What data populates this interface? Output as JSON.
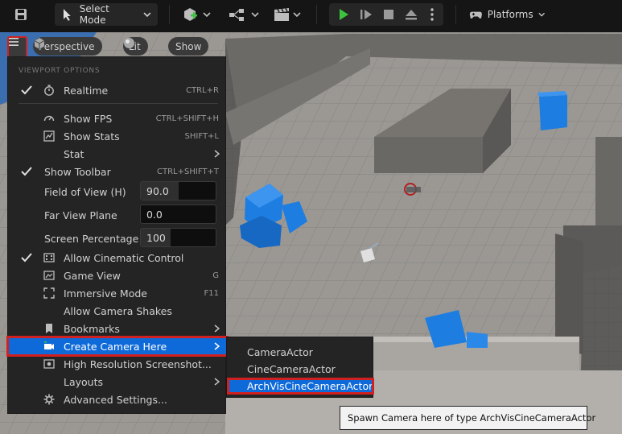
{
  "toolbar": {
    "save_icon": "save-icon",
    "select_mode_label": "Select Mode",
    "add_icon": "add-actor-icon",
    "blueprint_icon": "blueprint-icon",
    "cinematics_icon": "clapperboard-icon",
    "play_icons": [
      "play-icon",
      "advance-frame-icon",
      "stop-icon",
      "eject-icon",
      "kebab-icon"
    ],
    "play_color": "#3cc23c",
    "platforms_label": "Platforms"
  },
  "viewport_toolbar": {
    "perspective_label": "Perspective",
    "lit_label": "Lit",
    "show_label": "Show"
  },
  "menu": {
    "heading": "VIEWPORT OPTIONS",
    "items": [
      {
        "label": "Realtime",
        "shortcut": "CTRL+R",
        "checked": true,
        "icon": "stopwatch-icon"
      },
      {
        "label": "Show FPS",
        "shortcut": "CTRL+SHIFT+H",
        "checked": false,
        "icon": "speedometer-icon"
      },
      {
        "label": "Show Stats",
        "shortcut": "SHIFT+L",
        "checked": false,
        "icon": "stats-icon"
      },
      {
        "label": "Stat",
        "shortcut": "",
        "checked": false,
        "icon": "",
        "submenu": true
      },
      {
        "label": "Show Toolbar",
        "shortcut": "CTRL+SHIFT+T",
        "checked": true,
        "icon": ""
      },
      {
        "label": "Allow Cinematic Control",
        "shortcut": "",
        "checked": true,
        "icon": "film-icon"
      },
      {
        "label": "Game View",
        "shortcut": "G",
        "checked": false,
        "icon": "game-view-icon"
      },
      {
        "label": "Immersive Mode",
        "shortcut": "F11",
        "checked": false,
        "icon": "fullscreen-icon"
      },
      {
        "label": "Allow Camera Shakes",
        "shortcut": "",
        "checked": false,
        "icon": ""
      },
      {
        "label": "Bookmarks",
        "shortcut": "",
        "checked": false,
        "icon": "bookmark-icon",
        "submenu": true
      },
      {
        "label": "Create Camera Here",
        "shortcut": "",
        "checked": false,
        "icon": "camera-icon",
        "submenu": true
      },
      {
        "label": "High Resolution Screenshot...",
        "shortcut": "",
        "checked": false,
        "icon": "screenshot-icon"
      },
      {
        "label": "Layouts",
        "shortcut": "",
        "checked": false,
        "icon": "",
        "submenu": true
      },
      {
        "label": "Advanced Settings...",
        "shortcut": "",
        "checked": false,
        "icon": "gear-icon"
      }
    ],
    "fields": [
      {
        "label": "Field of View (H)",
        "value": "90.0",
        "fill": 0.5
      },
      {
        "label": "Far View Plane",
        "value": "0.0",
        "fill": 0
      },
      {
        "label": "Screen Percentage",
        "value": "100",
        "fill": 0.4
      }
    ]
  },
  "submenu": {
    "items": [
      "CameraActor",
      "CineCameraActor",
      "ArchVisCineCameraActor"
    ],
    "selected": "ArchVisCineCameraActor"
  },
  "tooltip": "Spawn Camera here of type ArchVisCineCameraActor",
  "colors": {
    "accent_blue": "#0e6ad8",
    "highlight_red": "#d02020",
    "cube_blue": "#1e7de0"
  }
}
